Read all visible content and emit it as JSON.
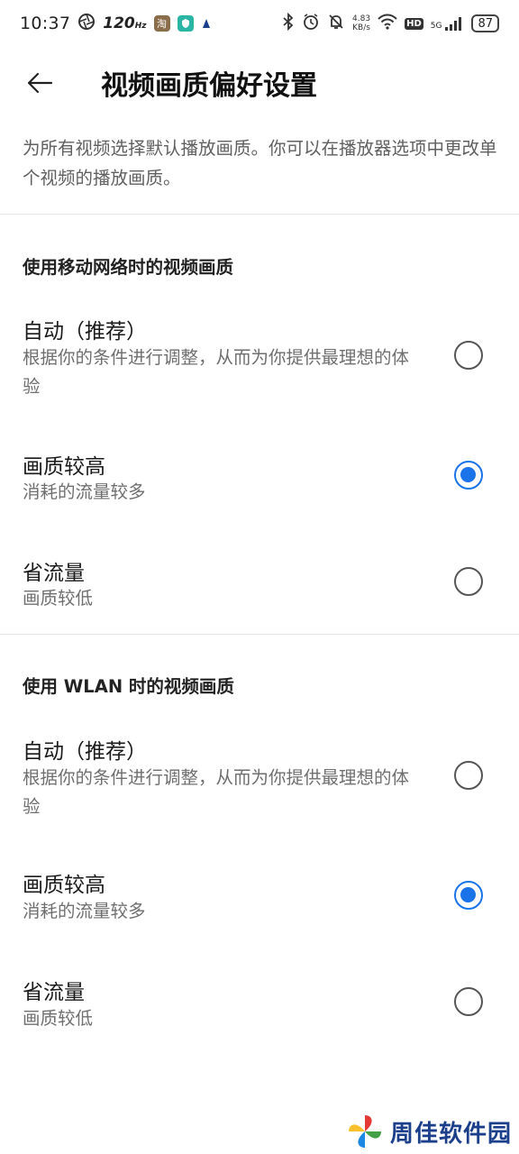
{
  "status_bar": {
    "time": "10:37",
    "refresh_rate": "120",
    "refresh_unit": "Hz",
    "net_speed_value": "4.83",
    "net_speed_unit": "KB/s",
    "hd_badge": "HD",
    "network_type": "5G",
    "battery": "87"
  },
  "app_bar": {
    "title": "视频画质偏好设置"
  },
  "intro_text": "为所有视频选择默认播放画质。你可以在播放器选项中更改单个视频的播放画质。",
  "sections": [
    {
      "title": "使用移动网络时的视频画质",
      "options": [
        {
          "title": "自动（推荐）",
          "description": "根据你的条件进行调整，从而为你提供最理想的体验",
          "selected": false
        },
        {
          "title": "画质较高",
          "description": "消耗的流量较多",
          "selected": true
        },
        {
          "title": "省流量",
          "description": "画质较低",
          "selected": false
        }
      ]
    },
    {
      "title": "使用 WLAN 时的视频画质",
      "options": [
        {
          "title": "自动（推荐）",
          "description": "根据你的条件进行调整，从而为你提供最理想的体验",
          "selected": false
        },
        {
          "title": "画质较高",
          "description": "消耗的流量较多",
          "selected": true
        },
        {
          "title": "省流量",
          "description": "画质较低",
          "selected": false
        }
      ]
    }
  ],
  "watermark": {
    "text": "周佳软件园"
  },
  "colors": {
    "accent": "#1a73e8",
    "secondary_text": "#6f6f6f"
  }
}
